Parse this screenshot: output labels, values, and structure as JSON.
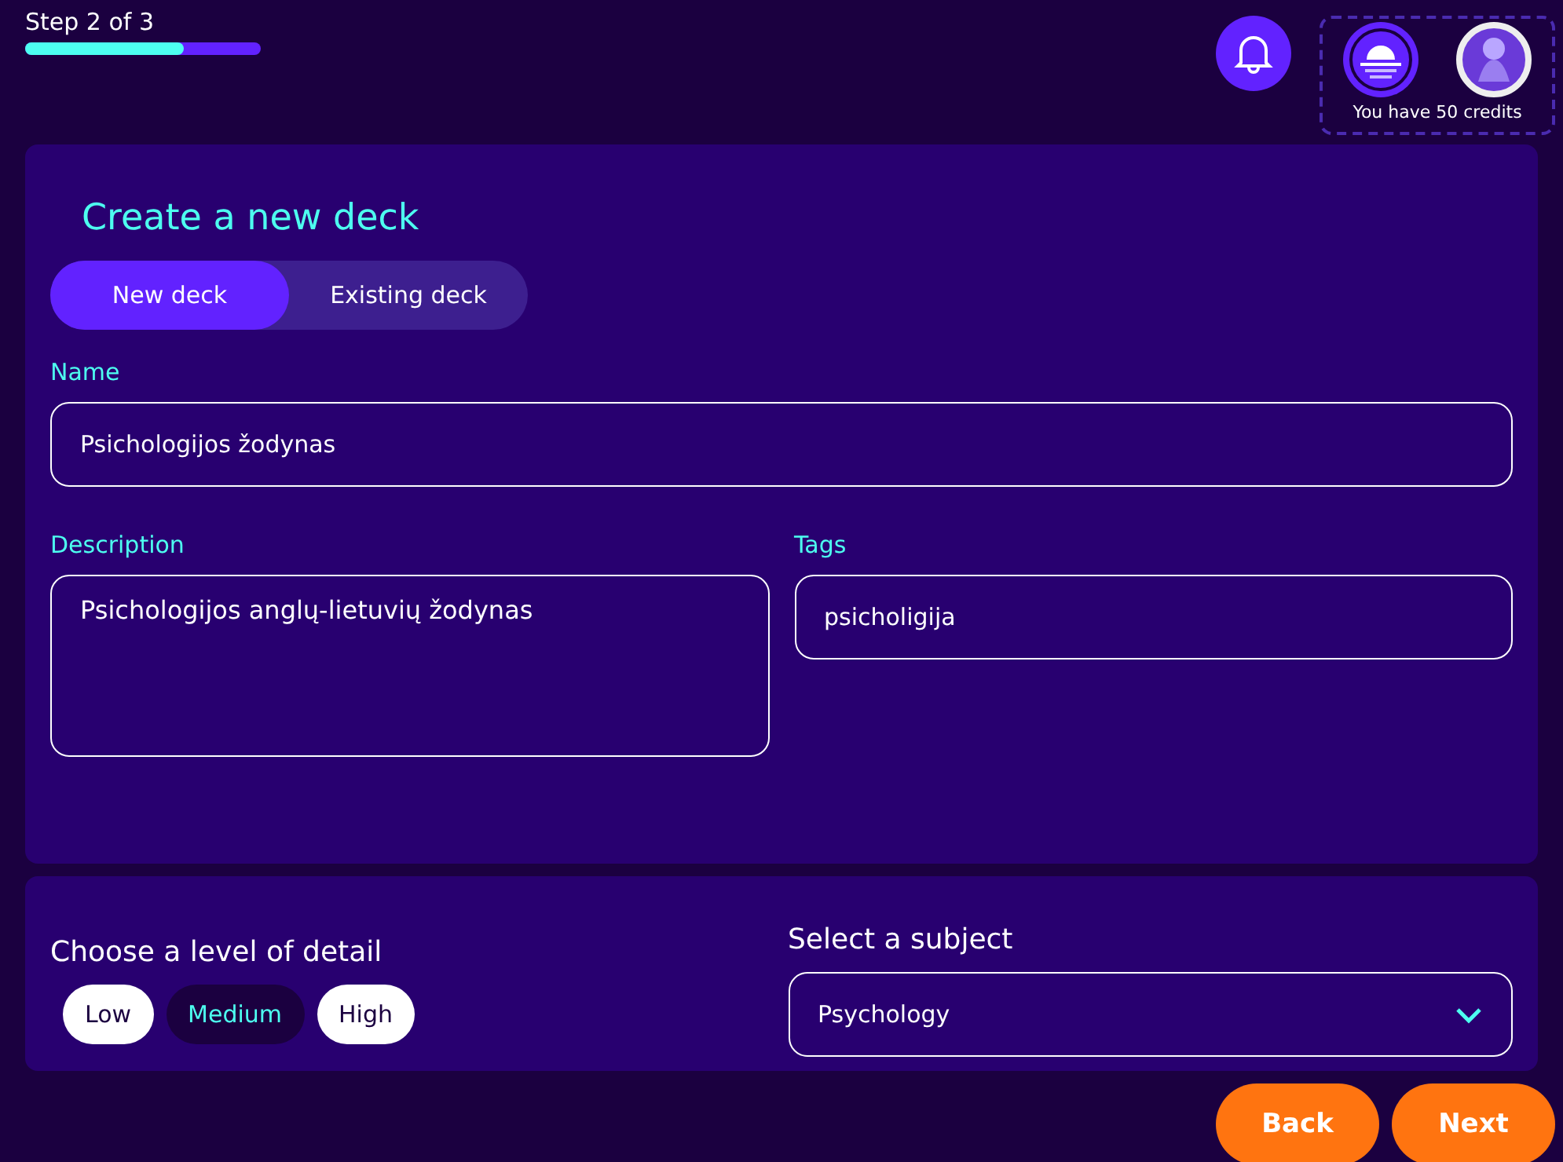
{
  "step": {
    "label": "Step 2 of 3",
    "level": 0.67
  },
  "header": {
    "credits": "You have 50 credits"
  },
  "deck": {
    "title": "Create a new deck",
    "tabs": [
      {
        "label": "New deck",
        "selected": true
      },
      {
        "label": "Existing deck",
        "selected": false
      }
    ],
    "name": {
      "label": "Name",
      "value": "Psichologijos žodynas"
    },
    "description": {
      "label": "Description",
      "value": "Psichologijos anglų-lietuvių žodynas"
    },
    "tags": {
      "label": "Tags",
      "value": "psicholigija"
    }
  },
  "detail": {
    "title": "Choose a level of detail",
    "levels": [
      {
        "label": "Low",
        "selected": false
      },
      {
        "label": "Medium",
        "selected": true
      },
      {
        "label": "High",
        "selected": false
      }
    ]
  },
  "subject": {
    "title": "Select a subject",
    "value": "Psychology"
  },
  "buttons": [
    "Back",
    "Next"
  ]
}
